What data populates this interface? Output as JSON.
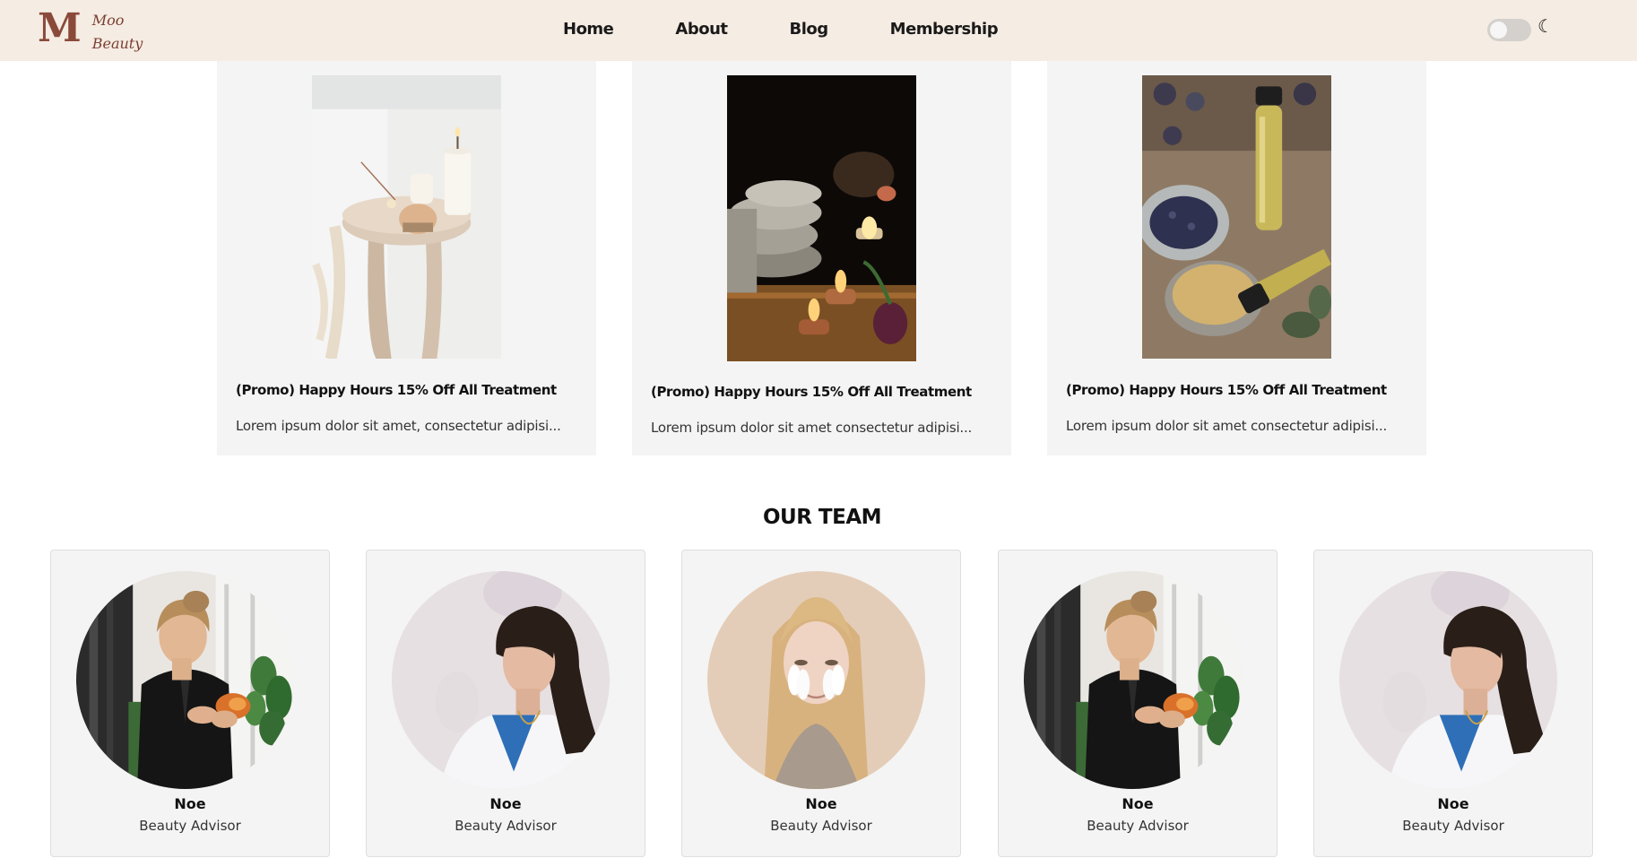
{
  "brand": {
    "logo_mark": "M",
    "line1": "Moo",
    "line2": "Beauty"
  },
  "nav": {
    "items": [
      {
        "label": "Home"
      },
      {
        "label": "About"
      },
      {
        "label": "Blog"
      },
      {
        "label": "Membership"
      }
    ]
  },
  "theme": {
    "dark_mode": false,
    "moon_glyph": "☾"
  },
  "promos": [
    {
      "title": "(Promo) Happy Hours 15% Off All Treatment",
      "description": "Lorem ipsum dolor sit amet, consectetur adipisi..."
    },
    {
      "title": "(Promo) Happy Hours 15% Off All Treatment",
      "description": "Lorem ipsum dolor sit amet consectetur adipisi..."
    },
    {
      "title": "(Promo) Happy Hours 15% Off All Treatment",
      "description": "Lorem ipsum dolor sit amet consectetur adipisi..."
    }
  ],
  "team": {
    "heading": "OUR TEAM",
    "members": [
      {
        "name": "Noe",
        "role": "Beauty Advisor"
      },
      {
        "name": "Noe",
        "role": "Beauty Advisor"
      },
      {
        "name": "Noe",
        "role": "Beauty Advisor"
      },
      {
        "name": "Noe",
        "role": "Beauty Advisor"
      },
      {
        "name": "Noe",
        "role": "Beauty Advisor"
      }
    ]
  },
  "colors": {
    "nav_bg": "#f5ece3",
    "brand": "#8a4a3a",
    "card_bg": "#f4f4f4"
  }
}
